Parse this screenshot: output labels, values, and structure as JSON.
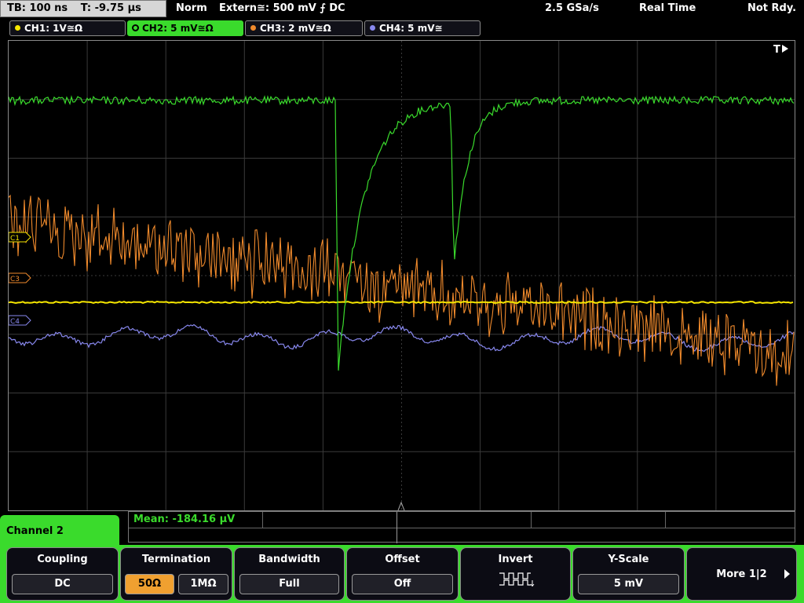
{
  "top": {
    "timebase": "TB: 100 ns",
    "trigger_time": "T: -9.75 µs",
    "mode": "Norm",
    "trigger_source": "Extern≅: 500 mV ⨍ DC",
    "sample_rate": "2.5 GSa/s",
    "acq_mode": "Real Time",
    "status": "Not Rdy."
  },
  "channels": [
    {
      "label": "CH1: 1V≅Ω",
      "color": "#f5e600"
    },
    {
      "label": "CH2: 5 mV≅Ω",
      "color": "#3adb2c"
    },
    {
      "label": "CH3: 2 mV≅Ω",
      "color": "#f08a2c"
    },
    {
      "label": "CH4: 5 mV≅",
      "color": "#8888ee"
    }
  ],
  "markers": {
    "c1": "C1",
    "c3": "C3",
    "c4": "C4",
    "trigger": "T"
  },
  "measurement": {
    "mean": "Mean: -184.16 µV"
  },
  "menu": {
    "title": "Channel 2",
    "coupling_title": "Coupling",
    "coupling_value": "DC",
    "termination_title": "Termination",
    "termination_50": "50Ω",
    "termination_1m": "1MΩ",
    "bandwidth_title": "Bandwidth",
    "bandwidth_value": "Full",
    "offset_title": "Offset",
    "offset_value": "Off",
    "invert_title": "Invert",
    "yscale_title": "Y-Scale",
    "yscale_value": "5 mV",
    "more_label": "More 1|2"
  },
  "colors": {
    "ch1": "#f5e600",
    "ch2": "#3adb2c",
    "ch3": "#f08a2c",
    "ch4": "#8888ee",
    "grid": "#3a3a3a"
  }
}
